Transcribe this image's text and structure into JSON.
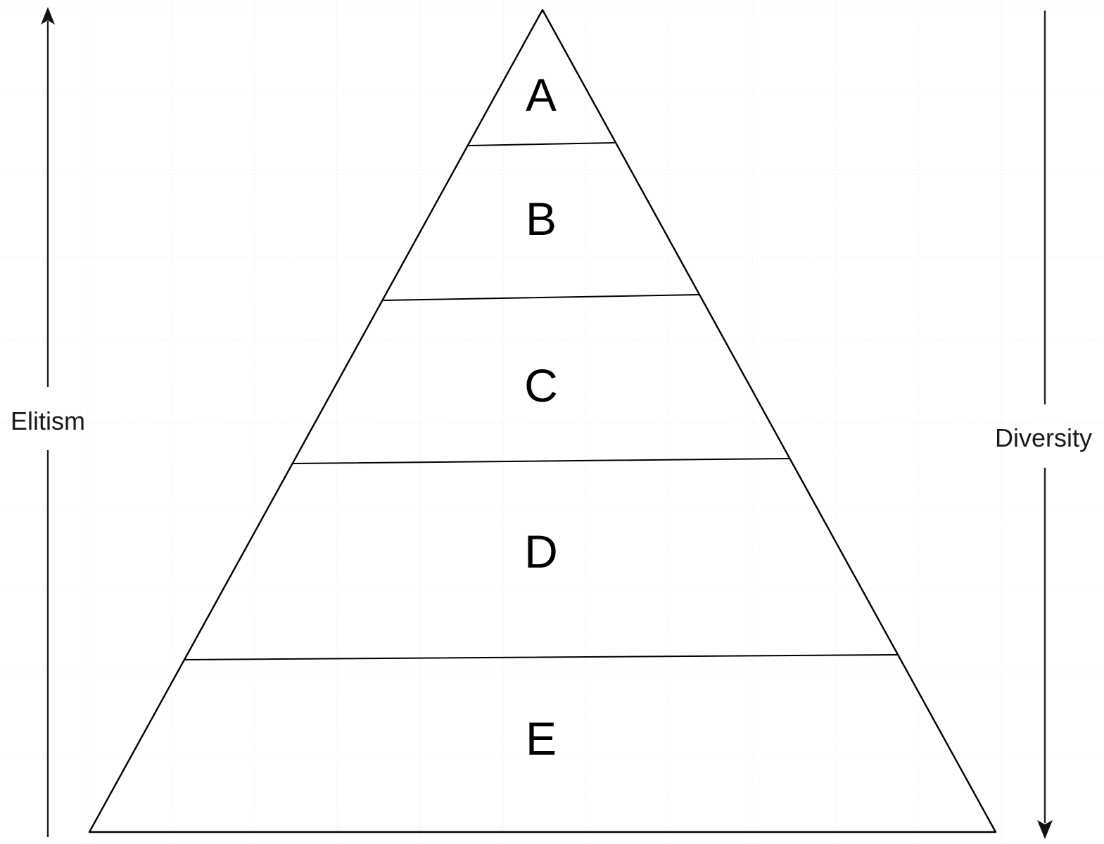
{
  "diagram": {
    "tiers": [
      {
        "label": "A"
      },
      {
        "label": "B"
      },
      {
        "label": "C"
      },
      {
        "label": "D"
      },
      {
        "label": "E"
      }
    ],
    "left_axis": {
      "label": "Elitism",
      "direction": "up"
    },
    "right_axis": {
      "label": "Diversity",
      "direction": "down"
    }
  }
}
